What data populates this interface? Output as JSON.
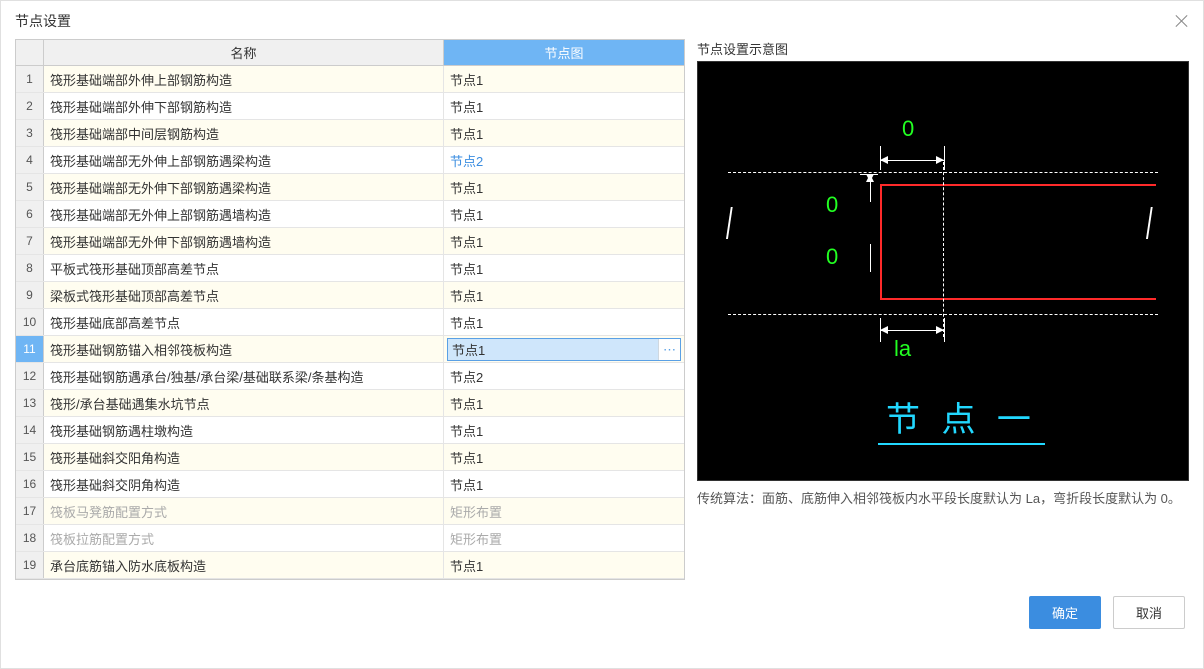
{
  "window": {
    "title": "节点设置"
  },
  "table": {
    "headers": {
      "name": "名称",
      "node": "节点图"
    },
    "rows": [
      {
        "idx": "1",
        "name": "筏形基础端部外伸上部钢筋构造",
        "node": "节点1",
        "alt": true
      },
      {
        "idx": "2",
        "name": "筏形基础端部外伸下部钢筋构造",
        "node": "节点1"
      },
      {
        "idx": "3",
        "name": "筏形基础端部中间层钢筋构造",
        "node": "节点1",
        "alt": true
      },
      {
        "idx": "4",
        "name": "筏形基础端部无外伸上部钢筋遇梁构造",
        "node": "节点2",
        "link": true
      },
      {
        "idx": "5",
        "name": "筏形基础端部无外伸下部钢筋遇梁构造",
        "node": "节点1",
        "alt": true
      },
      {
        "idx": "6",
        "name": "筏形基础端部无外伸上部钢筋遇墙构造",
        "node": "节点1"
      },
      {
        "idx": "7",
        "name": "筏形基础端部无外伸下部钢筋遇墙构造",
        "node": "节点1",
        "alt": true
      },
      {
        "idx": "8",
        "name": "平板式筏形基础顶部高差节点",
        "node": "节点1"
      },
      {
        "idx": "9",
        "name": "梁板式筏形基础顶部高差节点",
        "node": "节点1",
        "alt": true
      },
      {
        "idx": "10",
        "name": "筏形基础底部高差节点",
        "node": "节点1"
      },
      {
        "idx": "11",
        "name": "筏形基础钢筋锚入相邻筏板构造",
        "node": "节点1",
        "alt": true,
        "selected": true
      },
      {
        "idx": "12",
        "name": "筏形基础钢筋遇承台/独基/承台梁/基础联系梁/条基构造",
        "node": "节点2"
      },
      {
        "idx": "13",
        "name": "筏形/承台基础遇集水坑节点",
        "node": "节点1",
        "alt": true
      },
      {
        "idx": "14",
        "name": "筏形基础钢筋遇柱墩构造",
        "node": "节点1"
      },
      {
        "idx": "15",
        "name": "筏形基础斜交阳角构造",
        "node": "节点1",
        "alt": true
      },
      {
        "idx": "16",
        "name": "筏形基础斜交阴角构造",
        "node": "节点1"
      },
      {
        "idx": "17",
        "name": "筏板马凳筋配置方式",
        "node": "矩形布置",
        "alt": true,
        "disabled": true
      },
      {
        "idx": "18",
        "name": "筏板拉筋配置方式",
        "node": "矩形布置",
        "disabled": true
      },
      {
        "idx": "19",
        "name": "承台底筋锚入防水底板构造",
        "node": "节点1",
        "alt": true
      }
    ]
  },
  "editor": {
    "value": "节点1",
    "ellipsis": "⋯"
  },
  "preview": {
    "title": "节点设置示意图",
    "dim_top": "0",
    "dim_left_top": "0",
    "dim_left_bot": "0",
    "dim_bottom": "la",
    "node_label": "节 点 一"
  },
  "description": "传统算法：面筋、底筋伸入相邻筏板内水平段长度默认为 La，弯折段长度默认为 0。",
  "buttons": {
    "ok": "确定",
    "cancel": "取消"
  }
}
